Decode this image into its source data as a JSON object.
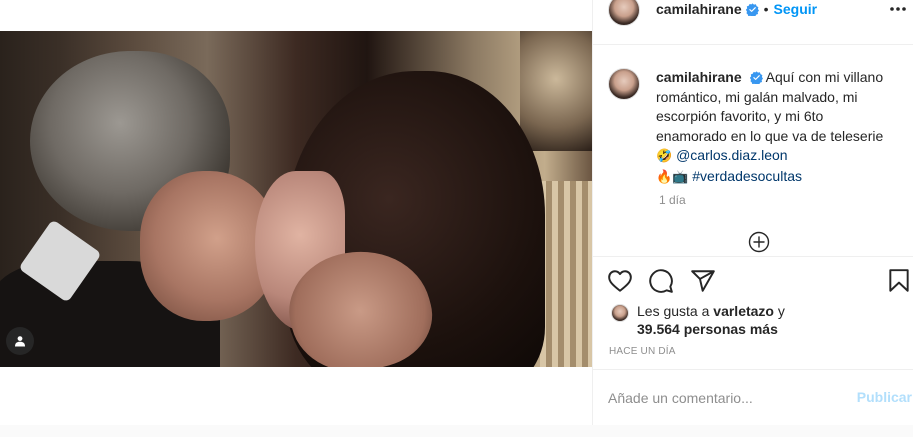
{
  "post": {
    "author": {
      "username": "camilahirane",
      "verified": true,
      "follow_label": "Seguir",
      "separator": "•"
    },
    "caption": {
      "username": "camilahirane",
      "text": "Aquí con mi villano romántico, mi galán malvado, mi escorpión favorito, y mi 6to enamorado en lo que va de teleserie",
      "emoji_laugh": "🤣",
      "mention": "@carlos.diaz.leon",
      "emoji_fire": "🔥",
      "emoji_tv": "📺",
      "hashtag": "#verdadesocultas",
      "time": "1 día"
    },
    "likes": {
      "prefix": "Les gusta a",
      "liker": "varletazo",
      "joiner": "y",
      "count": "39.564 personas más"
    },
    "timestamp": "HACE UN DÍA",
    "comment": {
      "placeholder": "Añade un comentario...",
      "publish_label": "Publicar"
    },
    "icons": {
      "tag": "user-tag-icon",
      "more": "more-options-icon",
      "like": "heart-icon",
      "comment": "comment-icon",
      "share": "share-icon",
      "save": "bookmark-icon",
      "load_more": "plus-circle-icon",
      "verified": "verified-badge-icon"
    },
    "colors": {
      "link_blue": "#0095f6",
      "mention_blue": "#00376b",
      "verified_blue": "#3897f0",
      "muted_gray": "#8e8e8e",
      "publish_disabled": "#b2dffc"
    }
  }
}
